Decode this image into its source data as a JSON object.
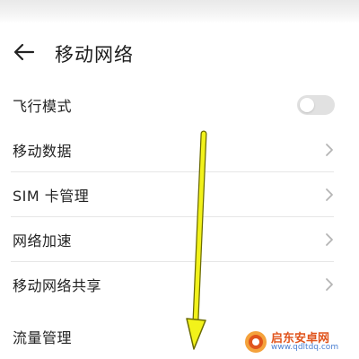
{
  "header": {
    "title": "移动网络",
    "back_icon": "arrow-left-icon"
  },
  "settings": {
    "airplane_mode": {
      "label": "飞行模式",
      "enabled": false
    },
    "items": [
      {
        "label": "移动数据",
        "icon": "chevron-right-icon"
      },
      {
        "label": "SIM 卡管理",
        "icon": "chevron-right-icon"
      },
      {
        "label": "网络加速",
        "icon": "chevron-right-icon"
      },
      {
        "label": "移动网络共享",
        "icon": "chevron-right-icon"
      }
    ],
    "traffic": {
      "label": "流量管理"
    }
  },
  "annotation": {
    "arrow_color": "#f2f21a",
    "icon": "yellow-down-arrow"
  },
  "watermark": {
    "name": "启东安卓网",
    "url": "www.qdltdq.com"
  },
  "colors": {
    "toggle_off": "#e1e1e1",
    "chevron": "#b5b5b5",
    "divider": "#e6e6e6",
    "watermark_name": "#e0541c",
    "watermark_url": "#4a7fd1"
  }
}
